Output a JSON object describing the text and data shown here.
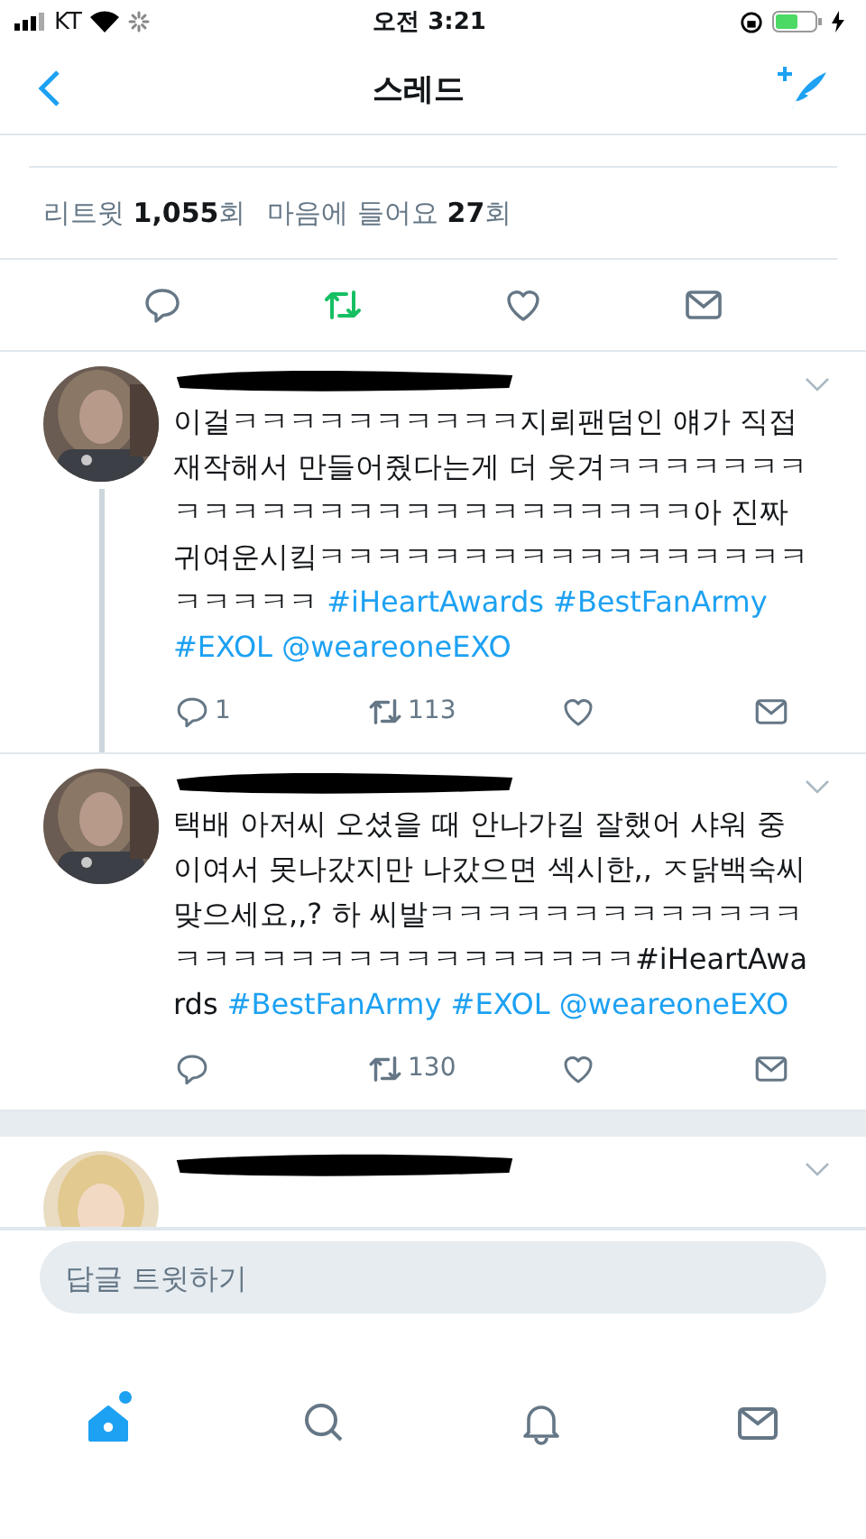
{
  "status_bar": {
    "carrier": "KT",
    "time": "오전 3:21"
  },
  "nav": {
    "title": "스레드"
  },
  "stats": [
    {
      "count": "1,055",
      "label_before": "리트윗",
      "label_after": "회"
    },
    {
      "count": "27",
      "label_before": "마음에 들어요",
      "label_after": "회"
    }
  ],
  "main_actions": {
    "retweeted": true,
    "liked": false
  },
  "tweets": [
    {
      "thread_line": true,
      "parts": [
        {
          "kind": "text",
          "text": "이걸ㅋㅋㅋㅋㅋㅋㅋㅋㅋㅋ지뢰팬덤인 얘가 직접 재작해서 만들어줬다는게 더 웃겨ㅋㅋㅋㅋㅋㅋㅋㅋㅋㅋㅋㅋㅋㅋㅋㅋㅋㅋㅋㅋㅋㅋㅋㅋㅋ아 진짜 귀여운시킼ㅋㅋㅋㅋㅋㅋㅋㅋㅋㅋㅋㅋㅋㅋㅋㅋㅋㅋㅋㅋㅋㅋ"
        },
        {
          "kind": "link",
          "text": "#iHeartAwards"
        },
        {
          "kind": "link",
          "text": "#BestFanArmy"
        },
        {
          "kind": "link",
          "text": "#EXOL"
        },
        {
          "kind": "link",
          "text": "@weareoneEXO"
        }
      ],
      "replies": "1",
      "retweets": "113"
    },
    {
      "thread_line": false,
      "parts": [
        {
          "kind": "text",
          "text": "택배 아저씨 오셨을 때 안나가길 잘했어 샤워 중이여서 못나갔지만 나갔으면 섹시한,, ㅈ닭백숙씨 맞으세요,,? 하 씨발ㅋㅋㅋㅋㅋㅋㅋㅋㅋㅋㅋㅋㅋㅋㅋㅋㅋㅋㅋㅋㅋㅋㅋㅋㅋㅋㅋㅋㅋ#iHeartAwards"
        },
        {
          "kind": "link",
          "text": "#BestFanArmy"
        },
        {
          "kind": "link",
          "text": "#EXOL"
        },
        {
          "kind": "link",
          "text": "@weareoneEXO"
        }
      ],
      "retweets": "130"
    }
  ],
  "reply_bar": {
    "placeholder": "답글 트윗하기"
  },
  "tabs": [
    {
      "kind": "home",
      "selected": true,
      "badge": true
    },
    {
      "kind": "search",
      "selected": false
    },
    {
      "kind": "notifications",
      "selected": false
    },
    {
      "kind": "messages",
      "selected": false
    }
  ]
}
